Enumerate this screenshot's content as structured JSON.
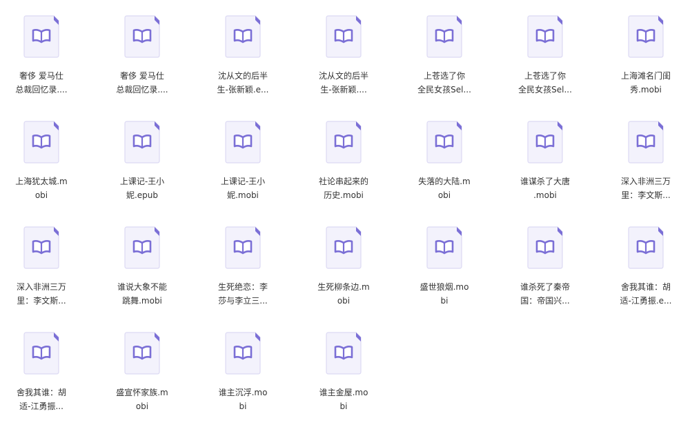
{
  "theme": {
    "icon_accent": "#7b6fd6",
    "icon_fill": "#f3f2fc",
    "icon_border": "#dcd9f3",
    "icon_book_bg": "#ffffff",
    "text_color": "#333333"
  },
  "files": [
    {
      "label": "奢侈 爱马仕\n总裁回忆录...."
    },
    {
      "label": "奢侈 爱马仕\n总裁回忆录...."
    },
    {
      "label": "沈从文的后半\n生-张新颖.e..."
    },
    {
      "label": "沈从文的后半\n生-张新颖...."
    },
    {
      "label": "上苍选了你\n全民女孩Sel..."
    },
    {
      "label": "上苍选了你\n全民女孩Sel..."
    },
    {
      "label": "上海滩名门闺\n秀.mobi"
    },
    {
      "label": "上海犹太城.m\nobi"
    },
    {
      "label": "上课记-王小\n妮.epub"
    },
    {
      "label": "上课记-王小\n妮.mobi"
    },
    {
      "label": "社论串起来的\n历史.mobi"
    },
    {
      "label": "失落的大陆.m\nobi"
    },
    {
      "label": "谁谋杀了大唐\n.mobi"
    },
    {
      "label": "深入非洲三万\n里：李文斯..."
    },
    {
      "label": "深入非洲三万\n里：李文斯..."
    },
    {
      "label": "谁说大象不能\n跳舞.mobi"
    },
    {
      "label": "生死绝恋：李\n莎与李立三..."
    },
    {
      "label": "生死柳条边.m\nobi"
    },
    {
      "label": "盛世狼烟.mo\nbi"
    },
    {
      "label": "谁杀死了秦帝\n国：帝国兴..."
    },
    {
      "label": "舍我其谁：胡\n适-江勇振.e..."
    },
    {
      "label": "舍我其谁：胡\n适-江勇振..."
    },
    {
      "label": "盛宣怀家族.m\nobi"
    },
    {
      "label": "谁主沉浮.mo\nbi"
    },
    {
      "label": "谁主金屋.mo\nbi"
    }
  ]
}
